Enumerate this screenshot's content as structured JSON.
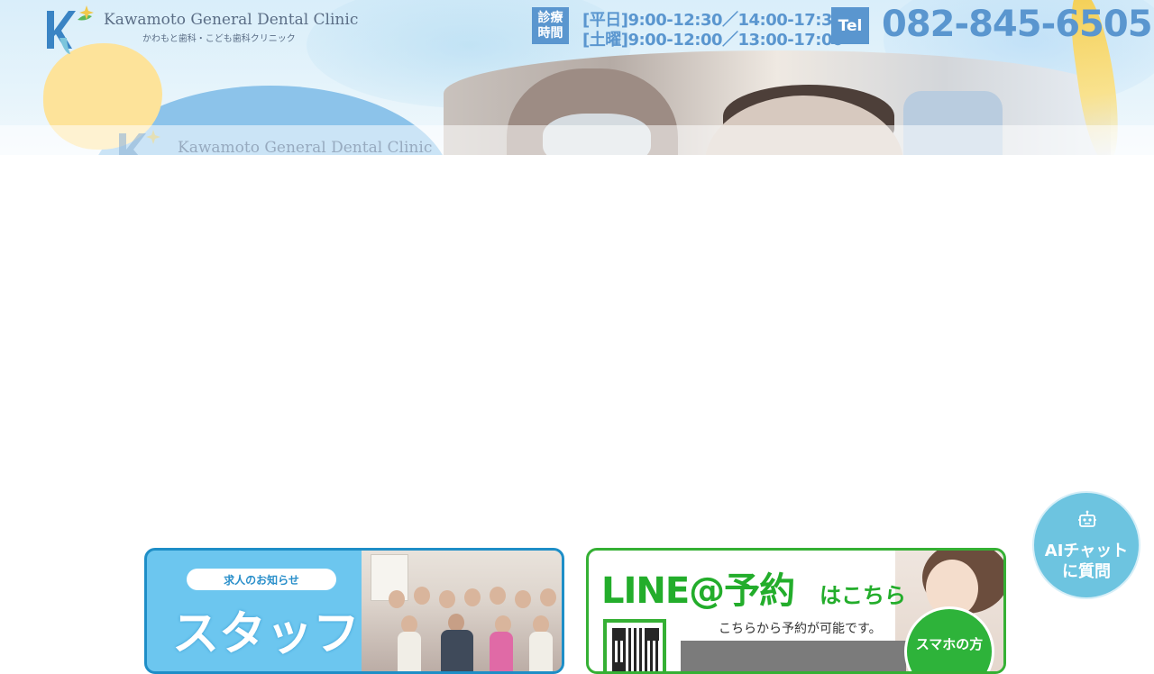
{
  "header": {
    "logo_name": "Kawamoto General Dental Clinic",
    "logo_sub": "かわもと歯科・こども歯科クリニック",
    "hours_badge_line1": "診療",
    "hours_badge_line2": "時間",
    "hours_weekday": "[平日]9:00-12:30／14:00-17:30",
    "hours_saturday": "[土曜]9:00-12:00／13:00-17:00",
    "tel_badge": "Tel",
    "phone": "082-845-6505"
  },
  "hero": {
    "logo_name": "Kawamoto General Dental Clinic"
  },
  "banners": {
    "staff": {
      "pill": "求人のお知らせ",
      "title": "スタッフ"
    },
    "line": {
      "title": "LINE@予約",
      "title_suffix": "はこちら",
      "description": "こちらから予約が可能です。",
      "circle_label": "スマホの方"
    }
  },
  "ai_chat": {
    "line1": "AIチャット",
    "line2": "に質問",
    "icon": "robot-icon"
  },
  "colors": {
    "accent_blue": "#5a96cf",
    "line_green": "#23ad2b",
    "staff_blue": "#6cc6ef",
    "chat_blue": "#6dc4e0"
  }
}
